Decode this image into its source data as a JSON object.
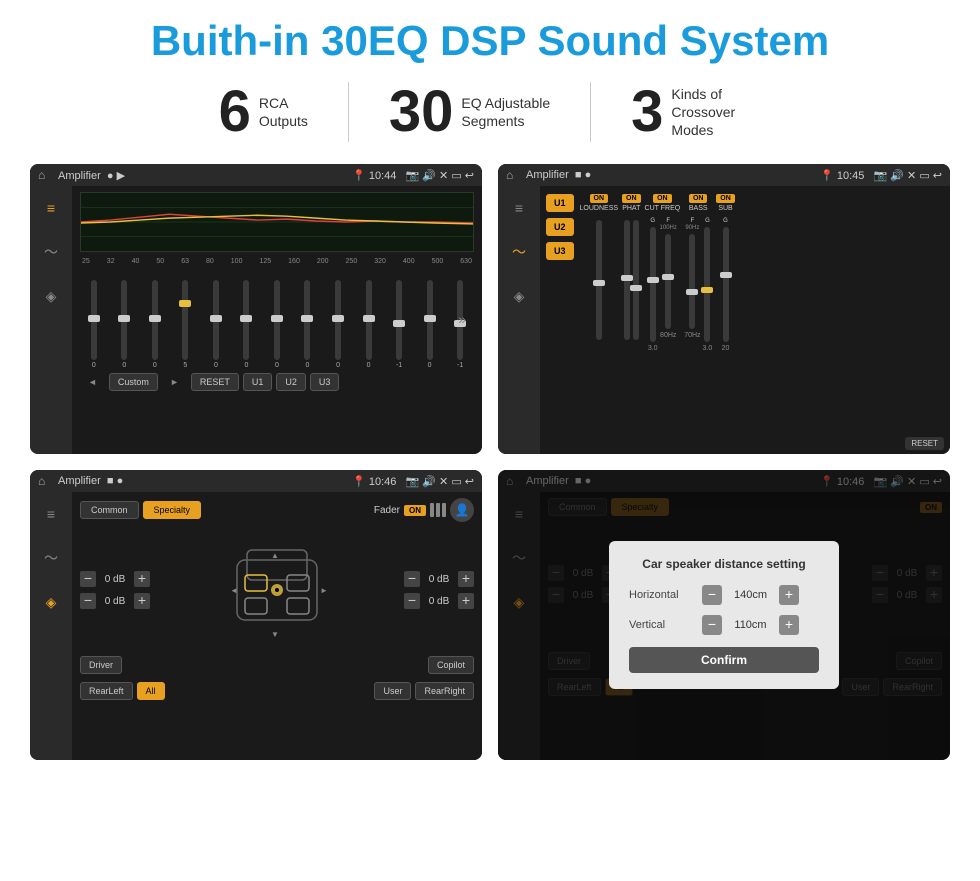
{
  "page": {
    "title": "Buith-in 30EQ DSP Sound System",
    "stats": [
      {
        "number": "6",
        "label": "RCA\nOutputs"
      },
      {
        "number": "30",
        "label": "EQ Adjustable\nSegments"
      },
      {
        "number": "3",
        "label": "Kinds of\nCrossover Modes"
      }
    ],
    "screens": [
      {
        "id": "eq-screen",
        "status_title": "Amplifier",
        "time": "10:44",
        "type": "eq",
        "freq_labels": [
          "25",
          "32",
          "40",
          "50",
          "63",
          "80",
          "100",
          "125",
          "160",
          "200",
          "250",
          "320",
          "400",
          "500",
          "630"
        ],
        "slider_values": [
          "0",
          "0",
          "0",
          "5",
          "0",
          "0",
          "0",
          "0",
          "0",
          "0",
          "-1",
          "0",
          "-1"
        ],
        "bottom_buttons": [
          "◄",
          "Custom",
          "►",
          "RESET",
          "U1",
          "U2",
          "U3"
        ]
      },
      {
        "id": "amp-screen",
        "status_title": "Amplifier",
        "time": "10:45",
        "type": "amplifier",
        "u_buttons": [
          "U1",
          "U2",
          "U3"
        ],
        "controls": [
          {
            "on": true,
            "label": "LOUDNESS"
          },
          {
            "on": true,
            "label": "PHAT"
          },
          {
            "on": true,
            "label": "CUT FREQ"
          },
          {
            "on": true,
            "label": "BASS"
          },
          {
            "on": true,
            "label": "SUB"
          }
        ],
        "reset_label": "RESET"
      },
      {
        "id": "fader-screen",
        "status_title": "Amplifier",
        "time": "10:46",
        "type": "fader",
        "tabs": [
          "Common",
          "Specialty"
        ],
        "fader_label": "Fader",
        "fader_on": "ON",
        "db_values": [
          "0 dB",
          "0 dB",
          "0 dB",
          "0 dB"
        ],
        "bottom_buttons": [
          "Driver",
          "RearLeft",
          "All",
          "User",
          "RearRight",
          "Copilot"
        ]
      },
      {
        "id": "dialog-screen",
        "status_title": "Amplifier",
        "time": "10:46",
        "type": "dialog",
        "tabs": [
          "Common",
          "Specialty"
        ],
        "dialog": {
          "title": "Car speaker distance setting",
          "horizontal_label": "Horizontal",
          "horizontal_value": "140cm",
          "vertical_label": "Vertical",
          "vertical_value": "110cm",
          "confirm_label": "Confirm"
        },
        "db_values": [
          "0 dB",
          "0 dB"
        ],
        "bottom_buttons": [
          "Driver",
          "RearLeft",
          "All",
          "User",
          "RearRight",
          "Copilot"
        ]
      }
    ]
  }
}
